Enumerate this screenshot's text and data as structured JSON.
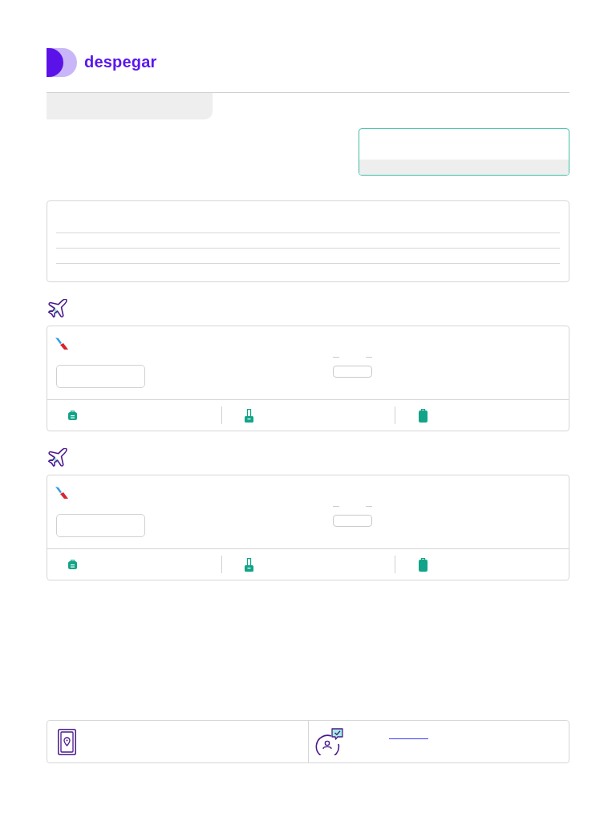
{
  "header": {
    "logo": "despegar"
  },
  "flights": [
    {
      "baggage": [
        {
          "kind": "backpack"
        },
        {
          "kind": "trolley"
        },
        {
          "kind": "suitcase"
        }
      ]
    },
    {
      "baggage": [
        {
          "kind": "backpack"
        },
        {
          "kind": "trolley"
        },
        {
          "kind": "suitcase"
        }
      ]
    }
  ],
  "footer": [
    {
      "kind": "app"
    },
    {
      "kind": "support"
    }
  ]
}
